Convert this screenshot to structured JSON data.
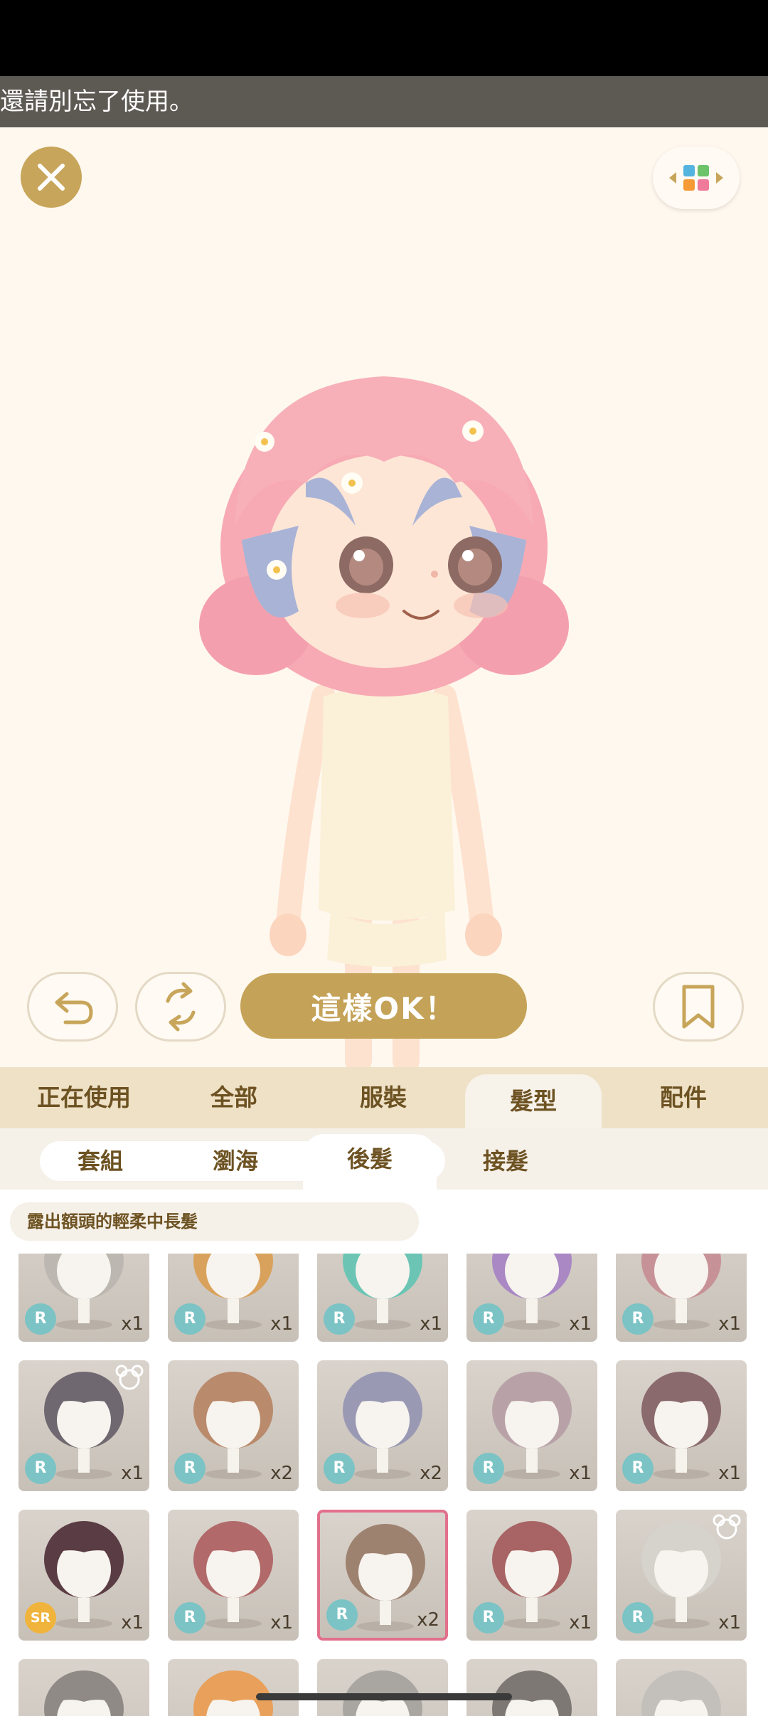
{
  "notice": {
    "text": "還請別忘了使用。"
  },
  "buttons": {
    "ok_label": "這樣OK！"
  },
  "categories": [
    {
      "label": "正在使用",
      "active": false
    },
    {
      "label": "全部",
      "active": false
    },
    {
      "label": "服裝",
      "active": false
    },
    {
      "label": "髮型",
      "active": true
    },
    {
      "label": "配件",
      "active": false
    }
  ],
  "subcategories": [
    {
      "label": "套組",
      "active": false
    },
    {
      "label": "瀏海",
      "active": false
    },
    {
      "label": "後髮",
      "active": true
    },
    {
      "label": "接髮",
      "active": false
    }
  ],
  "item_description": "露出額頭的輕柔中長髮",
  "items": [
    {
      "rarity": "R",
      "count": "x1",
      "hair": "#bdb7b1",
      "bear": false,
      "selected": false
    },
    {
      "rarity": "R",
      "count": "x1",
      "hair": "#d9a25c",
      "bear": false,
      "selected": false
    },
    {
      "rarity": "R",
      "count": "x1",
      "hair": "#6cc5b4",
      "bear": false,
      "selected": false
    },
    {
      "rarity": "R",
      "count": "x1",
      "hair": "#a988c4",
      "bear": false,
      "selected": false
    },
    {
      "rarity": "R",
      "count": "x1",
      "hair": "#c79297",
      "bear": false,
      "selected": false
    },
    {
      "rarity": "R",
      "count": "x1",
      "hair": "#6f6870",
      "bear": true,
      "selected": false
    },
    {
      "rarity": "R",
      "count": "x2",
      "hair": "#b98a6b",
      "bear": false,
      "selected": false
    },
    {
      "rarity": "R",
      "count": "x2",
      "hair": "#9a99b4",
      "bear": false,
      "selected": false
    },
    {
      "rarity": "R",
      "count": "x1",
      "hair": "#b8a2a7",
      "bear": false,
      "selected": false
    },
    {
      "rarity": "R",
      "count": "x1",
      "hair": "#8a6a6c",
      "bear": false,
      "selected": false
    },
    {
      "rarity": "SR",
      "count": "x1",
      "hair": "#5a3c44",
      "bear": false,
      "selected": false
    },
    {
      "rarity": "R",
      "count": "x1",
      "hair": "#b2696a",
      "bear": false,
      "selected": false
    },
    {
      "rarity": "R",
      "count": "x2",
      "hair": "#9e8270",
      "bear": false,
      "selected": true
    },
    {
      "rarity": "R",
      "count": "x1",
      "hair": "#a86464",
      "bear": false,
      "selected": false
    },
    {
      "rarity": "R",
      "count": "x1",
      "hair": "#d6d2cc",
      "bear": true,
      "selected": false
    },
    {
      "rarity": "",
      "count": "",
      "hair": "#8f8a86",
      "bear": false,
      "selected": false
    },
    {
      "rarity": "",
      "count": "",
      "hair": "#e8a05a",
      "bear": false,
      "selected": false
    },
    {
      "rarity": "",
      "count": "",
      "hair": "#a9a6a2",
      "bear": false,
      "selected": false
    },
    {
      "rarity": "",
      "count": "",
      "hair": "#7e7874",
      "bear": false,
      "selected": false
    },
    {
      "rarity": "",
      "count": "",
      "hair": "#c3c0bb",
      "bear": false,
      "selected": false
    }
  ],
  "icons": {
    "close": "close-icon",
    "style_switch": "color-grid-icon",
    "undo": "undo-arrow-icon",
    "random": "refresh-icon",
    "bookmark": "bookmark-icon"
  }
}
